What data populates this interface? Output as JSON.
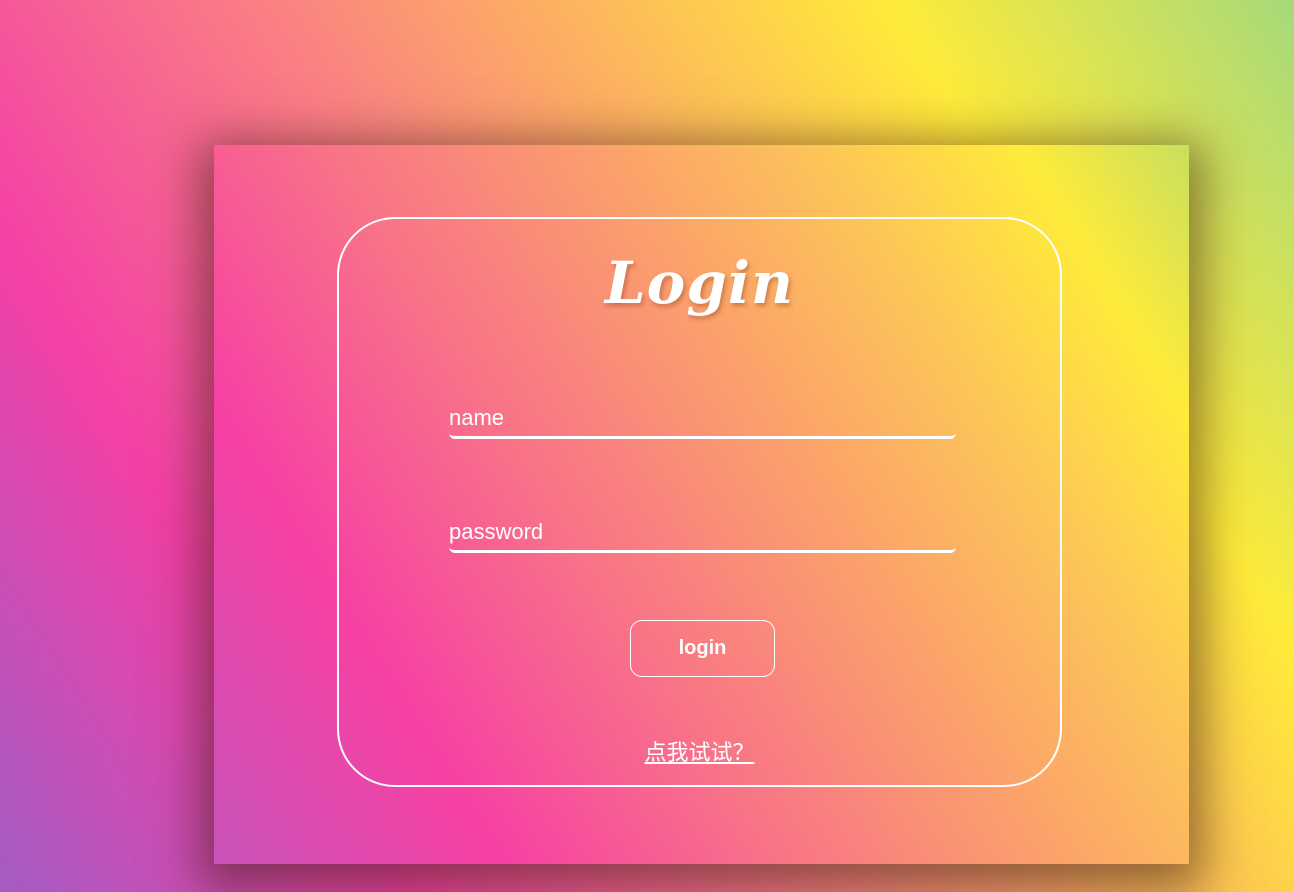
{
  "login_form": {
    "title": "Login",
    "name_placeholder": "name",
    "password_placeholder": "password",
    "login_button_label": "login",
    "try_link_text": "点我试试？"
  },
  "colors": {
    "text": "#ffffff",
    "border": "#ffffff",
    "gradient_stops": [
      "#a35cc4",
      "#f340a6",
      "#fa7f84",
      "#fdb85c",
      "#ffeb3a",
      "#a6d97a"
    ]
  }
}
